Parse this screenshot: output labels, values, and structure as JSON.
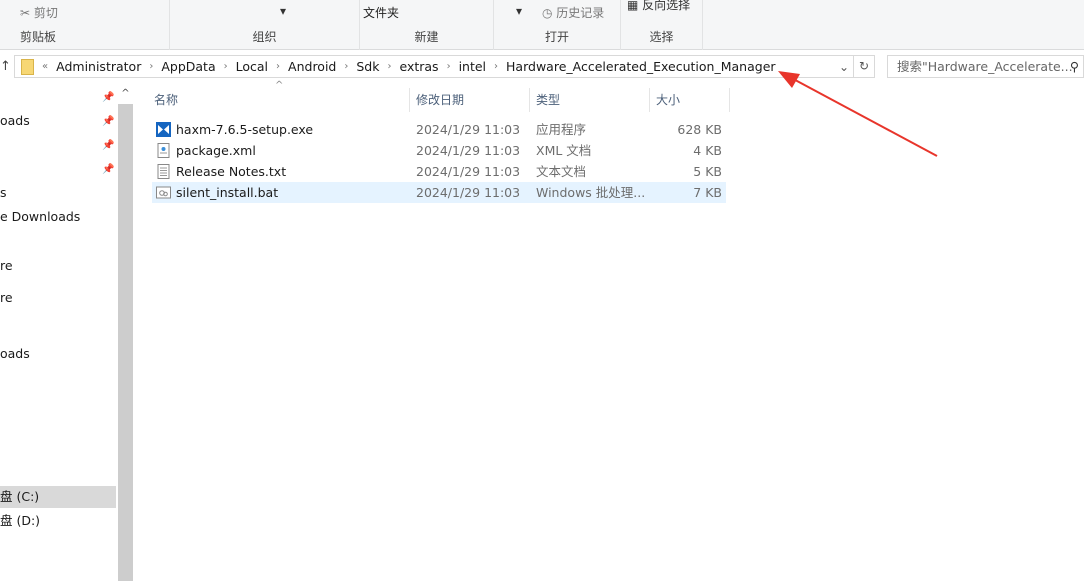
{
  "ribbon": {
    "cut": "剪切",
    "new_folder": "文件夹",
    "history": "历史记录",
    "invert_select": "反向选择",
    "groups": [
      "剪贴板",
      "组织",
      "新建",
      "打开",
      "选择"
    ]
  },
  "address": {
    "overflow": "«",
    "crumbs": [
      "Administrator",
      "AppData",
      "Local",
      "Android",
      "Sdk",
      "extras",
      "intel",
      "Hardware_Accelerated_Execution_Manager"
    ],
    "search_placeholder": "搜索\"Hardware_Accelerate..."
  },
  "nav": {
    "items": [
      "oads",
      "s",
      "e Downloads",
      "re",
      "re",
      "oads",
      "盘 (C:)",
      "盘 (D:)"
    ]
  },
  "columns": {
    "name": "名称",
    "date": "修改日期",
    "type": "类型",
    "size": "大小"
  },
  "files": [
    {
      "name": "haxm-7.6.5-setup.exe",
      "date": "2024/1/29 11:03",
      "type": "应用程序",
      "size": "628 KB",
      "icon": "exe-icon"
    },
    {
      "name": "package.xml",
      "date": "2024/1/29 11:03",
      "type": "XML 文档",
      "size": "4 KB",
      "icon": "xml-icon"
    },
    {
      "name": "Release Notes.txt",
      "date": "2024/1/29 11:03",
      "type": "文本文档",
      "size": "5 KB",
      "icon": "text-file-icon"
    },
    {
      "name": "silent_install.bat",
      "date": "2024/1/29 11:03",
      "type": "Windows 批处理...",
      "size": "7 KB",
      "icon": "batch-file-icon"
    }
  ],
  "colors": {
    "selected_row": "#e5f3ff",
    "annotation_arrow": "#e8352b"
  }
}
